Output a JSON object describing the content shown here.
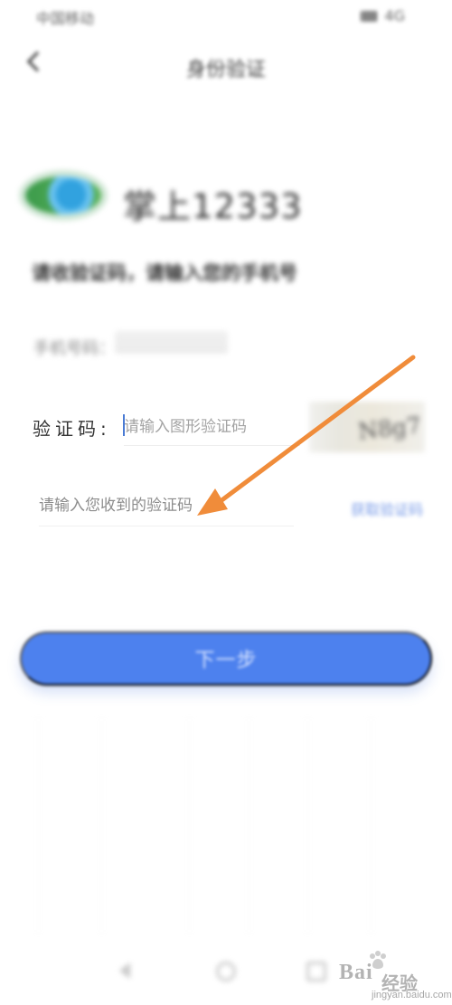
{
  "status_bar": {
    "left_text": "中国移动",
    "right_text": "4G"
  },
  "header": {
    "title": "身份验证",
    "back_icon": "chevron-left-icon"
  },
  "brand": {
    "name": "掌上12333"
  },
  "form": {
    "instruction": "请收验证码，请输入您的手机号",
    "phone_label": "手机号码：",
    "captcha_label": "验证码:",
    "captcha_placeholder": "请输入图形验证码",
    "captcha_image_text": "N8g7",
    "sms_placeholder": "请输入您收到的验证码",
    "get_code_label": "获取验证码"
  },
  "actions": {
    "next_label": "下一步"
  },
  "watermark": {
    "url": "jingyan.baidu.com"
  },
  "colors": {
    "primary_button": "#4d81ee",
    "annotation_arrow": "#f08c3a",
    "link_blue": "#7a9ce8"
  }
}
